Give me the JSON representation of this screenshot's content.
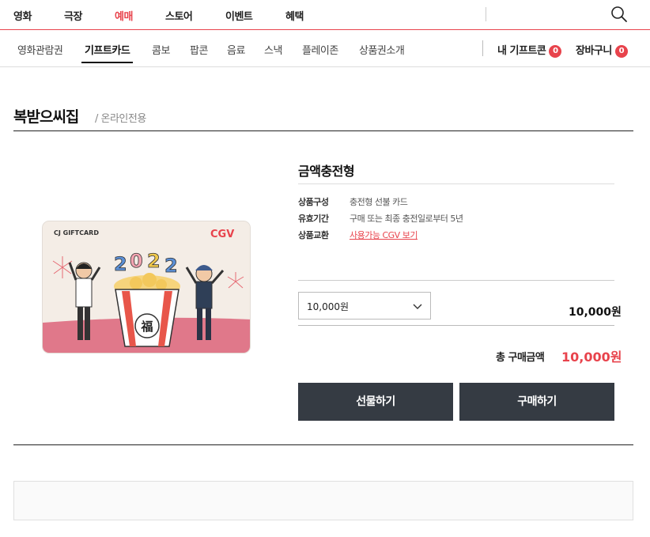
{
  "top_nav": {
    "items": [
      "영화",
      "극장",
      "예매",
      "스토어",
      "이벤트",
      "혜택"
    ],
    "active_index": 2
  },
  "sub_nav": {
    "items": [
      "영화관람권",
      "기프트카드",
      "콤보",
      "팝콘",
      "음료",
      "스낵",
      "플레이존",
      "상품권소개"
    ],
    "active_index": 1,
    "my_giftcon": "내 기프트콘",
    "my_giftcon_count": "0",
    "cart": "장바구니",
    "cart_count": "0"
  },
  "page": {
    "title": "복받으씨집",
    "subtitle": "/ 온라인전용"
  },
  "card": {
    "brand_label": "CJ GIFTCARD",
    "logo": "CGV",
    "year": "2022",
    "bucket_char": "福"
  },
  "product": {
    "title": "금액충전형",
    "info": [
      {
        "label": "상품구성",
        "value": "충전형 선불 카드"
      },
      {
        "label": "유효기간",
        "value": "구매 또는 최종 충전일로부터 5년"
      },
      {
        "label": "상품교환",
        "value": "사용가능 CGV 보기"
      }
    ],
    "selected_amount": "10,000원",
    "line_price": "10,000원",
    "total_label": "총 구매금액",
    "total_value": "10,000원",
    "gift_button": "선물하기",
    "buy_button": "구매하기"
  },
  "colors": {
    "accent": "#e8434c",
    "button_bg": "#353b43"
  }
}
